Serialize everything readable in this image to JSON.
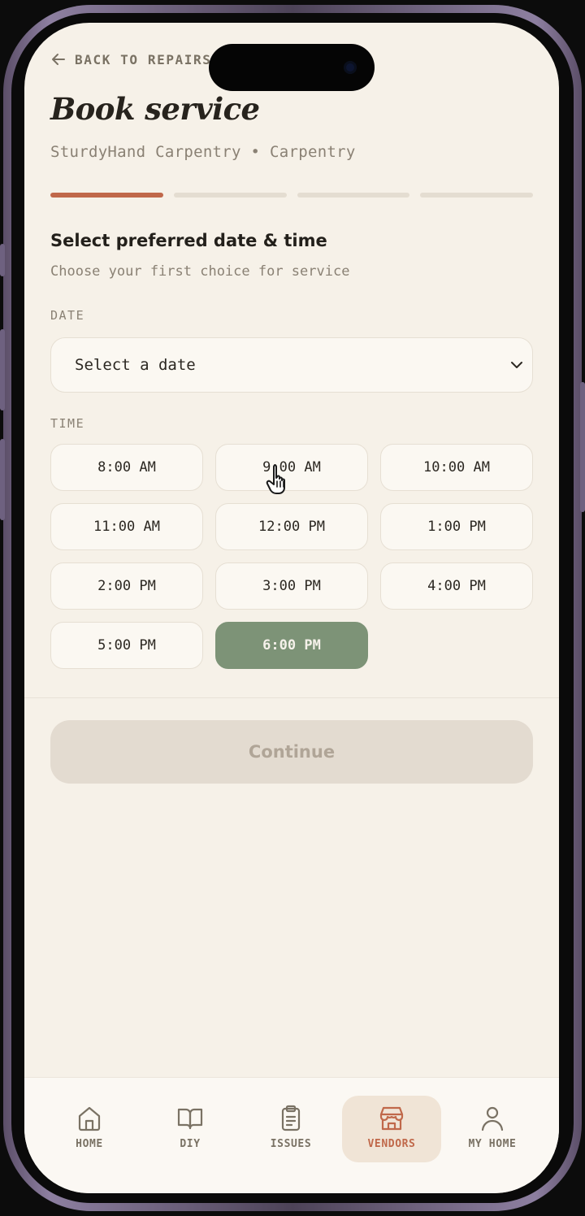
{
  "header": {
    "back_label": "BACK TO REPAIRS",
    "title": "Book service",
    "vendor_line": "SturdyHand Carpentry • Carpentry"
  },
  "progress": {
    "steps": 4,
    "current_step": 1
  },
  "section": {
    "heading": "Select preferred date & time",
    "subheading": "Choose your first choice for service"
  },
  "date": {
    "label": "DATE",
    "value": "Select a date"
  },
  "time": {
    "label": "TIME",
    "slots": [
      "8:00 AM",
      "9:00 AM",
      "10:00 AM",
      "11:00 AM",
      "12:00 PM",
      "1:00 PM",
      "2:00 PM",
      "3:00 PM",
      "4:00 PM",
      "5:00 PM",
      "6:00 PM"
    ],
    "selected": "6:00 PM"
  },
  "continue_label": "Continue",
  "tabs": [
    {
      "label": "HOME",
      "icon": "home-icon"
    },
    {
      "label": "DIY",
      "icon": "book-icon"
    },
    {
      "label": "ISSUES",
      "icon": "clipboard-icon"
    },
    {
      "label": "VENDORS",
      "icon": "store-icon",
      "active": true
    },
    {
      "label": "MY HOME",
      "icon": "user-icon"
    }
  ],
  "colors": {
    "accent": "#c0684a",
    "selected_slot": "#7d9377",
    "background": "#f6f1e8"
  }
}
